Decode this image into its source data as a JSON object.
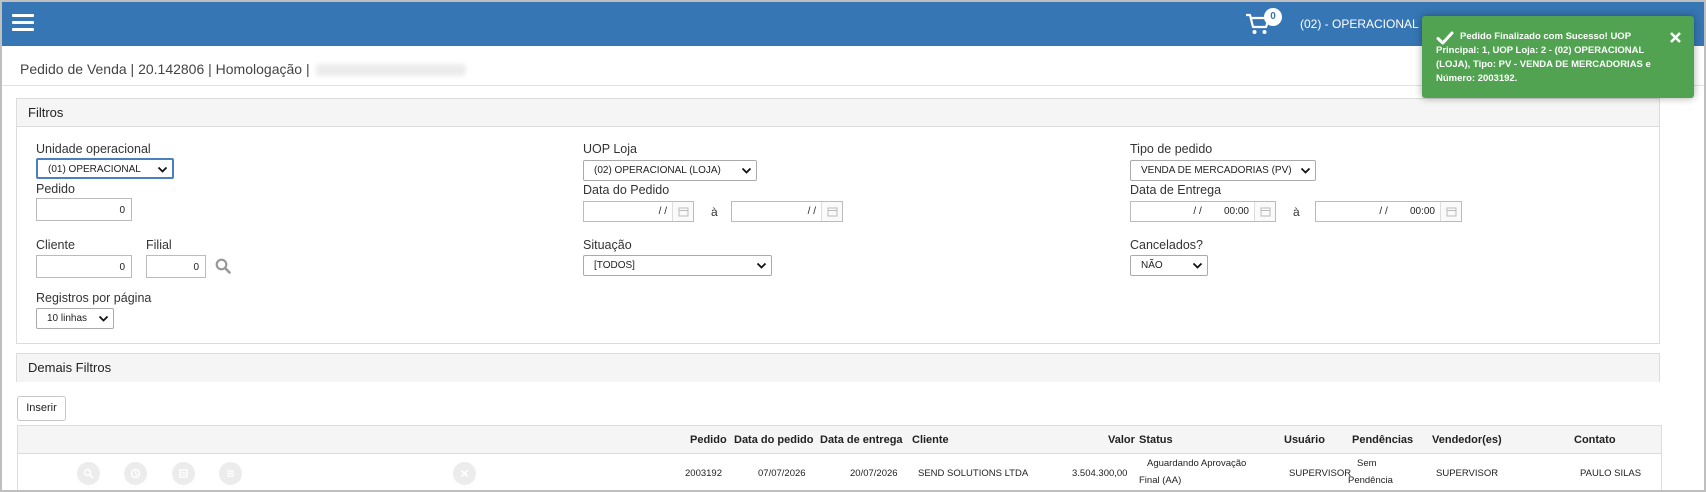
{
  "header": {
    "cart_count": "0",
    "uop_label": "(02) - OPERACIONAL ("
  },
  "breadcrumb": {
    "text": "Pedido de Venda | 20.142806 | Homologação |"
  },
  "filters": {
    "title": "Filtros",
    "unidade_label": "Unidade operacional",
    "unidade_value": "(01) OPERACIONAL",
    "uop_loja_label": "UOP Loja",
    "uop_loja_value": "(02) OPERACIONAL (LOJA)",
    "tipo_label": "Tipo de pedido",
    "tipo_value": "VENDA DE MERCADORIAS (PV)",
    "pedido_label": "Pedido",
    "pedido_value": "0",
    "data_pedido_label": "Data do Pedido",
    "data_pedido_from": "/ /",
    "data_pedido_to": "/ /",
    "a_label": "à",
    "data_entrega_label": "Data de Entrega",
    "data_entrega_from": "/ /        00:00",
    "data_entrega_to": "/ /        00:00",
    "cliente_label": "Cliente",
    "cliente_value": "0",
    "filial_label": "Filial",
    "filial_value": "0",
    "situacao_label": "Situação",
    "situacao_value": "[TODOS]",
    "cancelados_label": "Cancelados?",
    "cancelados_value": "NÃO",
    "registros_label": "Registros por página",
    "registros_value": "10 linhas"
  },
  "demais": {
    "title": "Demais Filtros"
  },
  "inserir_label": "Inserir",
  "table": {
    "headers": {
      "pedido": "Pedido",
      "data_pedido": "Data do pedido",
      "data_entrega": "Data de entrega",
      "cliente": "Cliente",
      "valor": "Valor",
      "status": "Status",
      "usuario": "Usuário",
      "pendencias": "Pendências",
      "vendedores": "Vendedor(es)",
      "contato": "Contato"
    },
    "rows": [
      {
        "pedido": "2003192",
        "data_pedido": "07/07/2026",
        "data_entrega": "20/07/2026",
        "cliente": "SEND SOLUTIONS LTDA",
        "valor": "3.504.300,00",
        "status": "Aguardando Aprovação Final (AA)",
        "usuario": "SUPERVISOR",
        "pendencias": "Sem Pendência",
        "vendedores": "SUPERVISOR",
        "contato": "PAULO SILAS"
      }
    ]
  },
  "toast": {
    "message": "Pedido Finalizado com Sucesso! UOP Principal: 1, UOP Loja: 2 - (02) OPERACIONAL (LOJA), Tipo: PV - VENDA DE MERCADORIAS e Número: 2003192."
  },
  "colors": {
    "topbar": "#3676b4",
    "toast": "#51a351"
  }
}
